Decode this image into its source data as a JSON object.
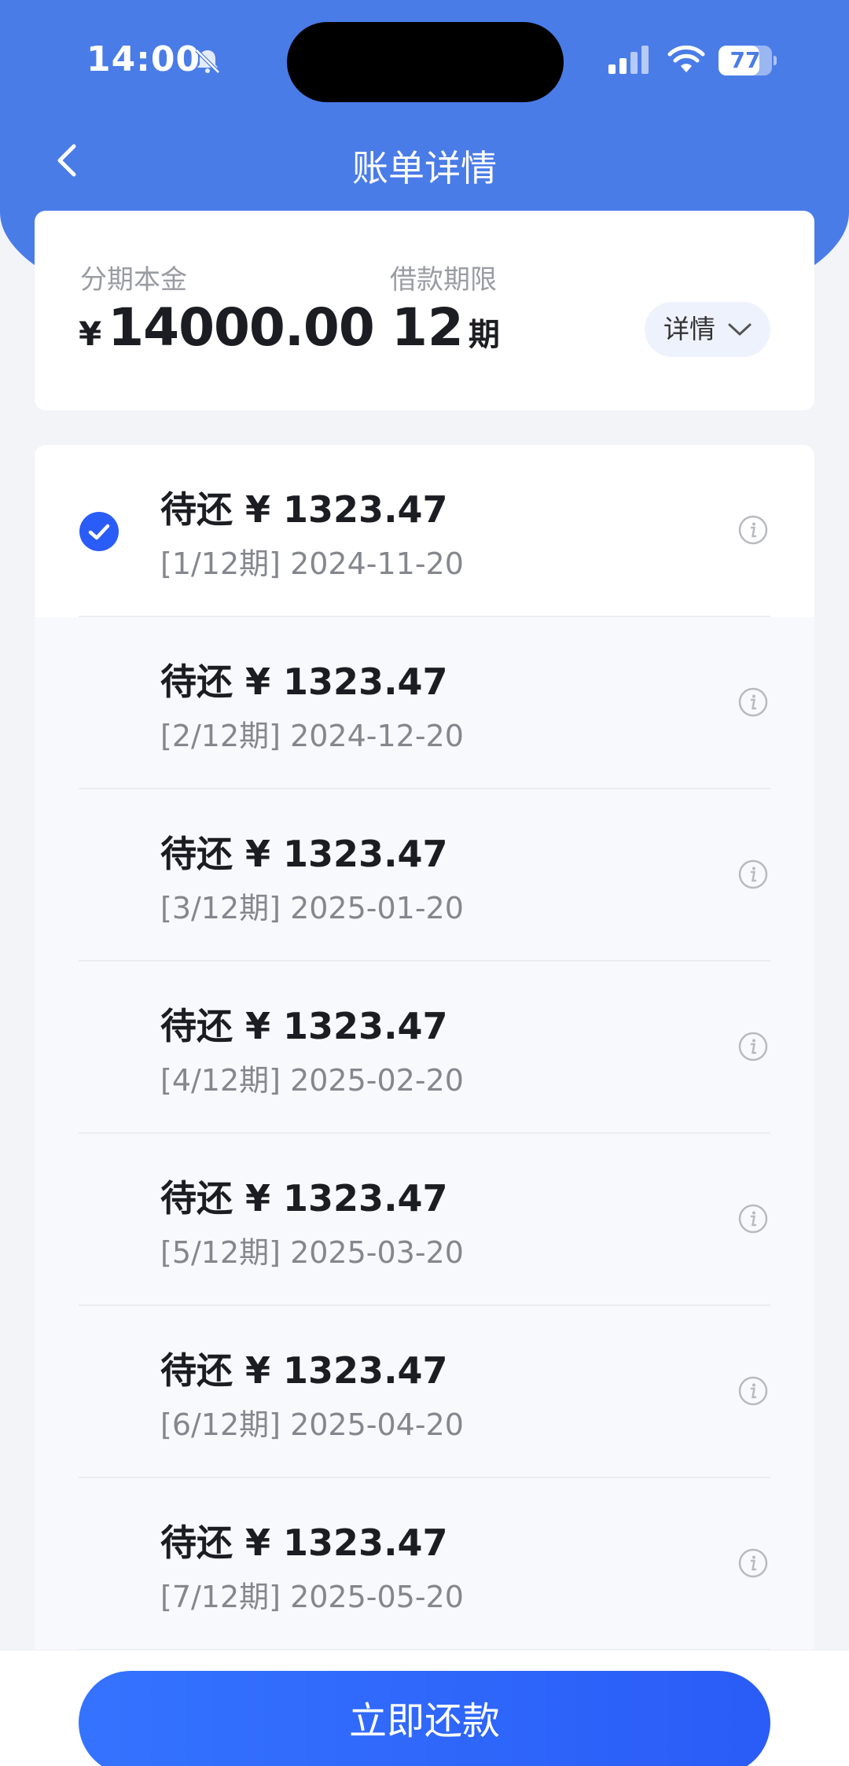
{
  "status_bar": {
    "time": "14:00",
    "battery_level": "77",
    "battery_fraction": 0.77
  },
  "nav": {
    "title": "账单详情"
  },
  "summary": {
    "principal_label": "分期本金",
    "currency": "¥",
    "principal_value": "14000.00",
    "term_label": "借款期限",
    "term_value": "12",
    "term_unit": "期",
    "detail_button": "详情"
  },
  "installments": [
    {
      "amount": "待还 ¥ 1323.47",
      "period": "[1/12期] 2024-11-20",
      "selected": true
    },
    {
      "amount": "待还 ¥ 1323.47",
      "period": "[2/12期] 2024-12-20",
      "selected": false
    },
    {
      "amount": "待还 ¥ 1323.47",
      "period": "[3/12期] 2025-01-20",
      "selected": false
    },
    {
      "amount": "待还 ¥ 1323.47",
      "period": "[4/12期] 2025-02-20",
      "selected": false
    },
    {
      "amount": "待还 ¥ 1323.47",
      "period": "[5/12期] 2025-03-20",
      "selected": false
    },
    {
      "amount": "待还 ¥ 1323.47",
      "period": "[6/12期] 2025-04-20",
      "selected": false
    },
    {
      "amount": "待还 ¥ 1323.47",
      "period": "[7/12期] 2025-05-20",
      "selected": false
    }
  ],
  "footer": {
    "pay_button": "立即还款"
  },
  "colors": {
    "header_blue": "#4a7ce8",
    "accent_blue": "#2a5cf7",
    "text_dark": "#1c1d22",
    "text_gray": "#85878e"
  },
  "icons": {
    "back": "chevron-left-icon",
    "mute": "bell-slash-icon",
    "signal": "cellular-signal-icon",
    "wifi": "wifi-icon",
    "check": "checkmark-circle-icon",
    "info": "info-circle-icon",
    "expand": "chevron-down-icon"
  }
}
